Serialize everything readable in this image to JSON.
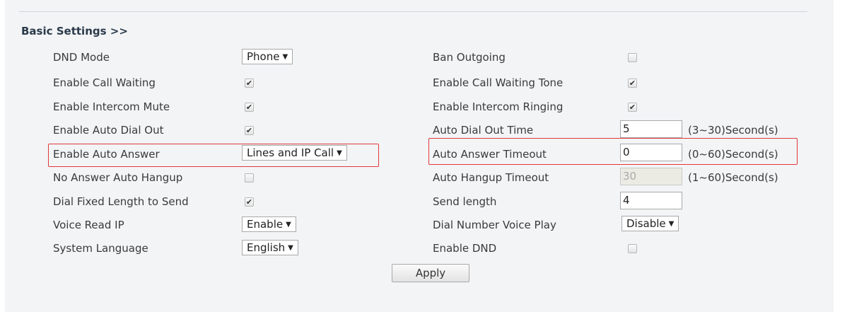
{
  "section": {
    "title": "Basic Settings >>"
  },
  "left": [
    {
      "label": "DND Mode",
      "control": "select",
      "value": "Phone"
    },
    {
      "label": "Enable Call Waiting",
      "control": "checkbox",
      "checked": true
    },
    {
      "label": "Enable Intercom Mute",
      "control": "checkbox",
      "checked": true
    },
    {
      "label": "Enable Auto Dial Out",
      "control": "checkbox",
      "checked": true
    },
    {
      "label": "Enable Auto Answer",
      "control": "select",
      "value": "Lines and IP Call"
    },
    {
      "label": "No Answer Auto Hangup",
      "control": "checkbox",
      "checked": false
    },
    {
      "label": "Dial Fixed Length to Send",
      "control": "checkbox",
      "checked": true
    },
    {
      "label": "Voice Read IP",
      "control": "select",
      "value": "Enable"
    },
    {
      "label": "System Language",
      "control": "select",
      "value": "English"
    }
  ],
  "right": [
    {
      "label": "Ban Outgoing",
      "control": "checkbox",
      "checked": false
    },
    {
      "label": "Enable Call Waiting Tone",
      "control": "checkbox",
      "checked": true
    },
    {
      "label": "Enable Intercom Ringing",
      "control": "checkbox",
      "checked": true
    },
    {
      "label": "Auto Dial Out Time",
      "control": "input",
      "value": "5",
      "hint": "(3~30)Second(s)"
    },
    {
      "label": "Auto Answer Timeout",
      "control": "input",
      "value": "0",
      "hint": "(0~60)Second(s)"
    },
    {
      "label": "Auto Hangup Timeout",
      "control": "input",
      "value": "30",
      "hint": "(1~60)Second(s)",
      "disabled": true
    },
    {
      "label": "Send length",
      "control": "input",
      "value": "4"
    },
    {
      "label": "Dial Number Voice Play",
      "control": "select",
      "value": "Disable"
    },
    {
      "label": "Enable DND",
      "control": "checkbox",
      "checked": false
    }
  ],
  "actions": {
    "apply_label": "Apply"
  },
  "icons": {
    "dropdown": "dropdown-arrow-icon",
    "check": "checkmark-icon"
  },
  "colors": {
    "highlight": "#e0393b",
    "panel_bg": "#f3f4f6"
  }
}
